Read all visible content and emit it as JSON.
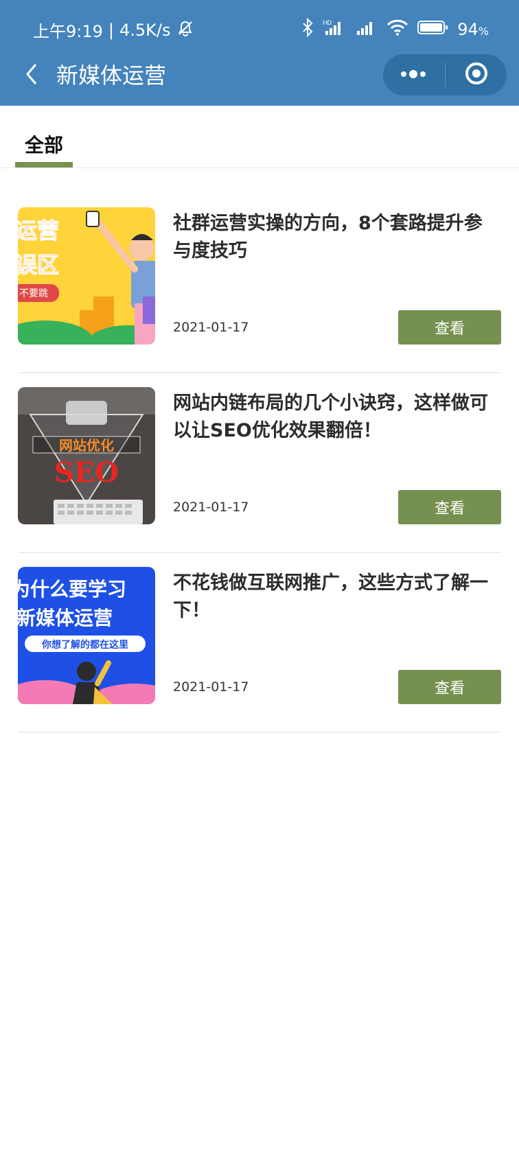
{
  "status": {
    "time": "上午9:19",
    "speed": "4.5K/s",
    "battery": "94"
  },
  "nav": {
    "title": "新媒体运营",
    "back_icon": "chevron-left-icon",
    "more_icon": "more-dots-icon",
    "close_icon": "circle-target-icon"
  },
  "tabs": [
    {
      "label": "全部",
      "active": true
    }
  ],
  "colors": {
    "header_bg": "#4483bb",
    "button_bg": "#76914f",
    "tab_underline": "#7a9150"
  },
  "articles": [
    {
      "title": "社群运营实操的方向，8个套路提升参与度技巧",
      "date": "2021-01-17",
      "button": "查看",
      "thumb_text_1": "运营",
      "thumb_text_2": "误区",
      "thumb_text_3": "不要跳"
    },
    {
      "title": "网站内链布局的几个小诀窍，这样做可以让SEO优化效果翻倍！",
      "date": "2021-01-17",
      "button": "查看",
      "thumb_text_1": "网站优化",
      "thumb_text_2": "SEO"
    },
    {
      "title": "不花钱做互联网推广，这些方式了解一下！",
      "date": "2021-01-17",
      "button": "查看",
      "thumb_text_1": "为什么要学习",
      "thumb_text_2": "新媒体运营",
      "thumb_text_3": "你想了解的都在这里"
    }
  ]
}
